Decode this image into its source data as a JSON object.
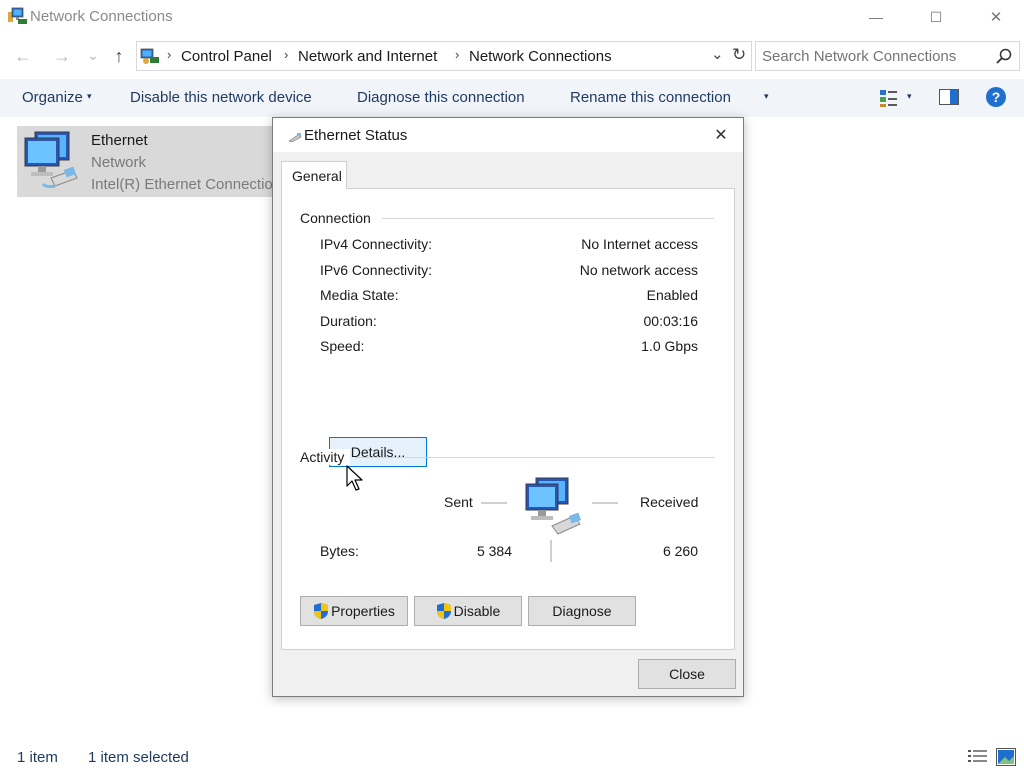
{
  "window": {
    "title": "Network Connections",
    "minimize_glyph": "—",
    "maximize_glyph": "☐",
    "close_glyph": "✕"
  },
  "nav": {
    "back_glyph": "←",
    "forward_glyph": "→",
    "recent_glyph": "⌄",
    "up_glyph": "↑"
  },
  "breadcrumb": {
    "items": [
      "Control Panel",
      "Network and Internet",
      "Network Connections"
    ],
    "separator": "›",
    "dropdown_glyph": "⌄",
    "refresh_glyph": "↻"
  },
  "search": {
    "placeholder": "Search Network Connections"
  },
  "toolbar": {
    "organize": "Organize",
    "organize_arrow": "▾",
    "disable_device": "Disable this network device",
    "diagnose_connection": "Diagnose this connection",
    "rename_connection": "Rename this connection",
    "more_arrow": "▾",
    "view_arrow": "▾",
    "help_glyph": "?"
  },
  "item": {
    "name": "Ethernet",
    "network": "Network",
    "adapter": "Intel(R) Ethernet Connection"
  },
  "statusbar": {
    "count": "1 item",
    "selected": "1 item selected"
  },
  "dialog": {
    "title": "Ethernet Status",
    "close_glyph": "✕",
    "tab": "General",
    "connection_group": "Connection",
    "rows": [
      {
        "label": "IPv4 Connectivity:",
        "value": "No Internet access"
      },
      {
        "label": "IPv6 Connectivity:",
        "value": "No network access"
      },
      {
        "label": "Media State:",
        "value": "Enabled"
      },
      {
        "label": "Duration:",
        "value": "00:03:16"
      },
      {
        "label": "Speed:",
        "value": "1.0 Gbps"
      }
    ],
    "details_button": "Details...",
    "activity_group": "Activity",
    "sent_label": "Sent",
    "received_label": "Received",
    "bytes_label": "Bytes:",
    "bytes_sent": "5 384",
    "bytes_received": "6 260",
    "properties_button": "Properties",
    "disable_button": "Disable",
    "diagnose_button": "Diagnose",
    "close_button": "Close"
  },
  "colors": {
    "command_bar_bg": "#f1f4f9",
    "link_text": "#1e3a5f",
    "selection_bg": "#d9d9d9",
    "help_blue": "#1f6fd1"
  }
}
